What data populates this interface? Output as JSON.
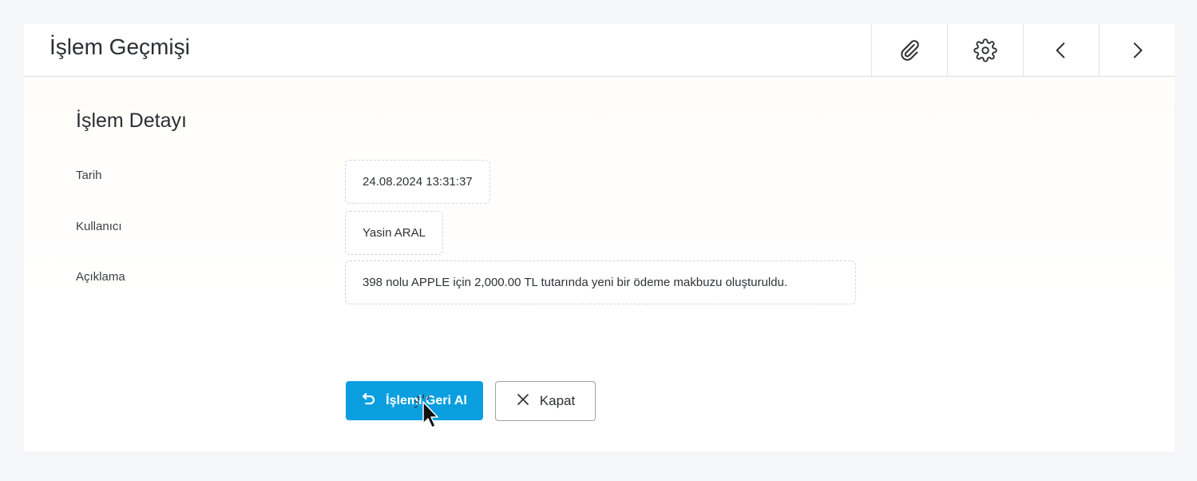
{
  "header": {
    "title": "İşlem Geçmişi",
    "tools": [
      {
        "name": "attachment-icon"
      },
      {
        "name": "gear-icon"
      },
      {
        "name": "chevron-left-icon"
      },
      {
        "name": "chevron-right-icon"
      }
    ]
  },
  "detail": {
    "section_title": "İşlem Detayı",
    "fields": [
      {
        "label": "Tarih",
        "value": "24.08.2024 13:31:37"
      },
      {
        "label": "Kullanıcı",
        "value": "Yasin ARAL"
      },
      {
        "label": "Açıklama",
        "value": "398 nolu APPLE için 2,000.00 TL tutarında yeni bir ödeme makbuzu oluşturuldu."
      }
    ]
  },
  "actions": {
    "undo_label": "İşlemi Geri Al",
    "undo_icon": "undo-icon",
    "close_label": "Kapat",
    "close_icon": "close-icon"
  },
  "colors": {
    "primary": "#0b9fe0",
    "text": "#2b2f33",
    "border": "#d3d6da"
  }
}
